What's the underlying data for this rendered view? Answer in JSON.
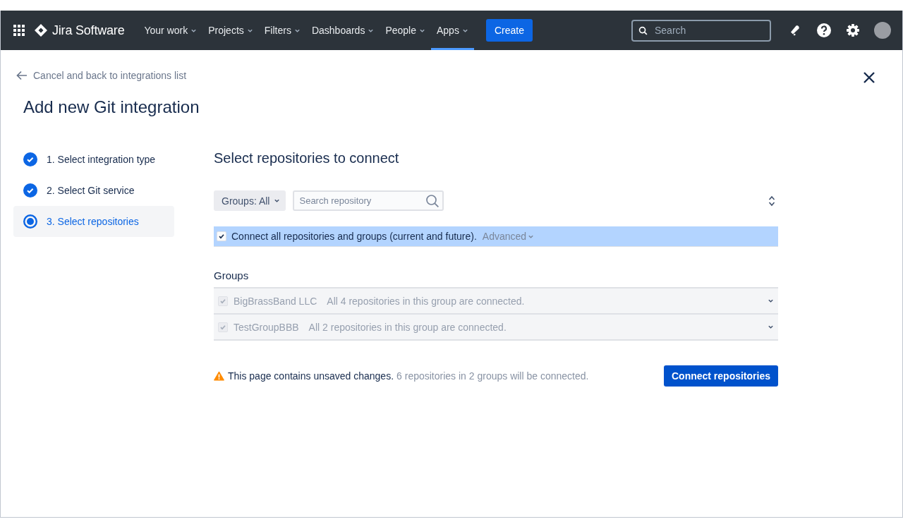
{
  "nav": {
    "product": "Jira Software",
    "menus": [
      {
        "label": "Your work",
        "selected": false
      },
      {
        "label": "Projects",
        "selected": false
      },
      {
        "label": "Filters",
        "selected": false
      },
      {
        "label": "Dashboards",
        "selected": false
      },
      {
        "label": "People",
        "selected": false
      },
      {
        "label": "Apps",
        "selected": true
      }
    ],
    "create": "Create",
    "search_placeholder": "Search"
  },
  "back_link": "Cancel and back to integrations list",
  "title": "Add new Git integration",
  "steps": [
    {
      "label": "1. Select integration type",
      "kind": "done",
      "selected": false
    },
    {
      "label": "2. Select Git service",
      "kind": "done",
      "selected": false
    },
    {
      "label": "3. Select repositories",
      "kind": "current",
      "selected": true
    }
  ],
  "panel": {
    "heading": "Select repositories to connect",
    "groups_filter": "Groups: All",
    "search_placeholder": "Search repository",
    "connect_all": {
      "label": "Connect all repositories and groups (current and future).",
      "checked": true,
      "advanced": "Advanced"
    },
    "groups_heading": "Groups",
    "groups": [
      {
        "name": "BigBrassBand LLC",
        "status": "All 4 repositories in this group are connected.",
        "checked": true,
        "disabled": true
      },
      {
        "name": "TestGroupBBB",
        "status": "All 2 repositories in this group are connected.",
        "checked": true,
        "disabled": true
      }
    ],
    "warning": "This page contains unsaved changes.",
    "summary": "6 repositories in 2 groups will be connected.",
    "button": "Connect repositories"
  }
}
